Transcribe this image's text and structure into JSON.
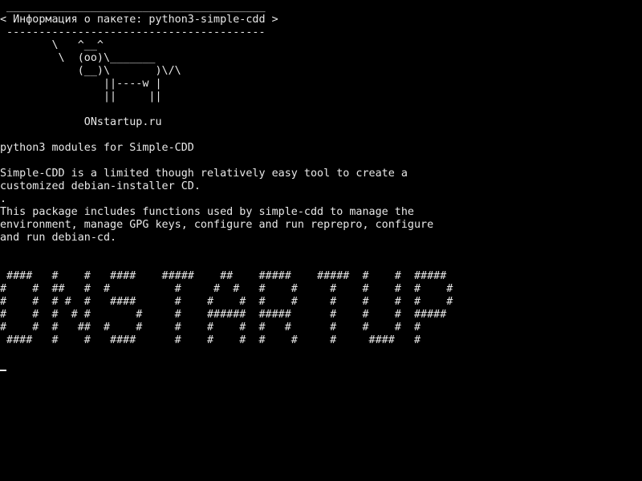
{
  "terminal": {
    "speech_bubble": {
      "top_border": " ________________________________________",
      "text": "< Информация о пакете: python3-simple-cdd >",
      "bottom_border": " ----------------------------------------"
    },
    "cow_art": "        \\   ^__^\n         \\  (oo)\\_______\n            (__)\\       )\\/\\\n                ||----w |\n                ||     ||",
    "site": "             ONstartup.ru",
    "description": {
      "summary": "python3 modules for Simple-CDD",
      "paragraph1": "Simple-CDD is a limited though relatively easy tool to create a\ncustomized debian-installer CD.",
      "separator": ".",
      "paragraph2": "This package includes functions used by simple-cdd to manage the\nenvironment, manage GPG keys, configure and run reprepro, configure\nand run debian-cd."
    },
    "banner_art": " ####   #    #   ####    #####    ##    #####    #####  #    #  #####\n#    #  ##   #  #          #     #  #   #    #     #    #    #  #    #\n#    #  # #  #   ####      #    #    #  #    #     #    #    #  #    #\n#    #  #  # #       #     #    ######  #####      #    #    #  #####\n#    #  #   ##  #    #     #    #    #  #   #      #    #    #  #\n ####   #    #   ####      #    #    #  #    #     #     ####   #"
  }
}
